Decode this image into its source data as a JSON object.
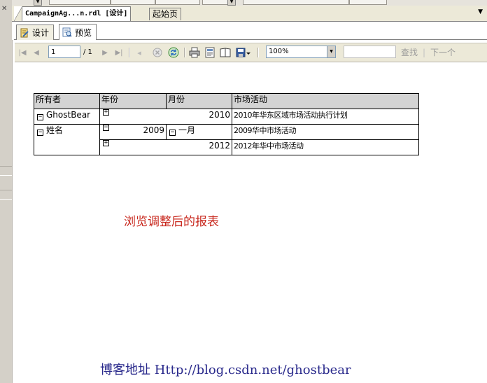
{
  "document_tabs": {
    "active": "CampaignAg...n.rdl [设计]",
    "other": "起始页"
  },
  "view_tabs": {
    "design": "设计",
    "preview": "预览"
  },
  "toolbar": {
    "page_current": "1",
    "page_of": "/ 1",
    "zoom": "100%",
    "find": "查找",
    "find_sep": "|",
    "next": "下一个"
  },
  "report": {
    "headers": [
      "所有者",
      "年份",
      "月份",
      "市场活动"
    ],
    "rows": {
      "r1": {
        "owner": "GhostBear",
        "year": "2010",
        "activity": "2010年华东区域市场活动执行计划"
      },
      "r2": {
        "owner": "姓名",
        "year": "2009",
        "month": "一月",
        "activity": "2009华中市场活动"
      },
      "r3": {
        "year": "2012",
        "activity": "2012年华中市场活动"
      }
    },
    "toggles": {
      "collapse": "−",
      "expand": "+"
    }
  },
  "caption": "浏览调整后的报表",
  "blog": "博客地址 Http://blog.csdn.net/ghostbear",
  "colors": {
    "caption": "#c8281e",
    "blog": "#2a2a8c",
    "header_bg": "#d3d3d3"
  }
}
